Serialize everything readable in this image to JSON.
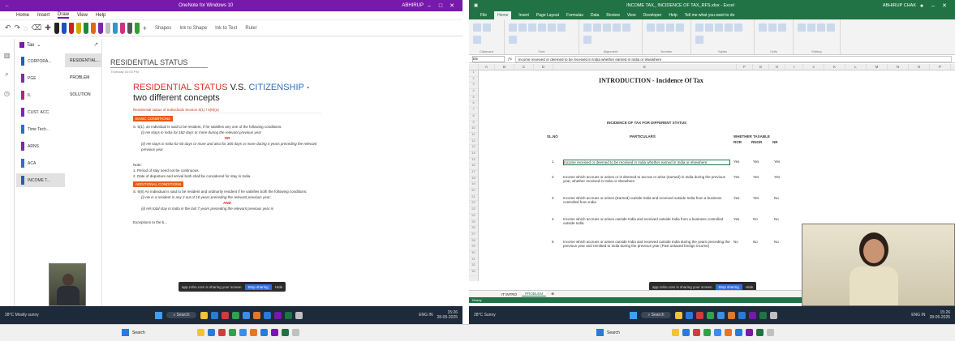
{
  "onenote": {
    "window_title": "OneNote for Windows 10",
    "user": "ABHIRUP",
    "menu": [
      "Home",
      "Insert",
      "Draw",
      "View",
      "Help"
    ],
    "active_menu": "Draw",
    "pen_colors": [
      "#222222",
      "#1f4fbf",
      "#d02020",
      "#d7a500",
      "#1a8a3a",
      "#e06a10",
      "#7a2ab0",
      "#c0c0c0",
      "#2a9ad0",
      "#d03080",
      "#555555",
      "#30a030"
    ],
    "tools": [
      "Shapes",
      "Ink to Shape",
      "Ink to Text",
      "Ruler"
    ],
    "notebook": "Tax",
    "sections": [
      {
        "label": "CORPORA...",
        "color": "#1f5fbf"
      },
      {
        "label": "PGE",
        "color": "#7a2ab0"
      },
      {
        "label": "IL",
        "color": "#c0207a"
      },
      {
        "label": "CUST. ACC.",
        "color": "#7a2ab0"
      },
      {
        "label": "Time Tech...",
        "color": "#2a70d0"
      },
      {
        "label": "ARNS",
        "color": "#7a2ab0"
      },
      {
        "label": "ACA",
        "color": "#2a70d0"
      },
      {
        "label": "INCOME T...",
        "color": "#1f5fbf"
      }
    ],
    "pages": [
      "RESIDENTIAL...",
      "PROBLEM",
      "SOLUTION"
    ],
    "page_title": "RESIDENTIAL STATUS",
    "page_date": "Thursday 02:00 PM",
    "heading_red": "RESIDENTIAL STATUS",
    "heading_vs": " V.S. ",
    "heading_blue": "CITIZENSHIP",
    "heading_rest": " - two different concepts",
    "sub_heading": "Residential status of Individuals Section 6(1) / 6(6)(a)",
    "basic_label": "BASIC CONDITIONS",
    "basic_intro": "S. 6(1), an individual is said to be resident, if he satisfies any one of the following conditions:",
    "basic_i": "(i) He stays in India for 182 days or more during the relevant previous year",
    "or_label": "OR",
    "basic_ii": "(ii) He stays in India for 60 days or more and also for 365 days or more during 4 years preceding the relevant previous year",
    "note_label": "Note:",
    "note_1": "1. Period of stay need not be continuous.",
    "note_2": "2. Date of departure and arrival both shall be considered for stay in India.",
    "add_label": "ADDITIONAL CONDITIONS",
    "add_intro": "S. 6(6) An individual is said to be resident and ordinarily resident if he satisfies both the following conditions:",
    "add_i": "(i) He is a resident in any 2 out of 10 years preceding the relevant previous year;",
    "and_label": "AND",
    "add_ii": "(ii) His total stay in India in the last 7 years preceding the relevant previous year is",
    "exceptions": "Exceptions to the b...",
    "share_msg": "app.zoho.com is sharing your screen",
    "share_stop": "Stop sharing",
    "share_hide": "Hide",
    "weather": "28°C",
    "weather_sub": "Mostly sunny",
    "search": "Search",
    "clock_time": "15:26",
    "clock_date": "28-05-2025",
    "lang": "ENG IN"
  },
  "excel": {
    "window_title": "INCOME TAX_ INCIDENCE OF TAX_RFS.xlsx - Excel",
    "user": "ABHIRUP CHAK",
    "menu": [
      "File",
      "Home",
      "Insert",
      "Page Layout",
      "Formulas",
      "Data",
      "Review",
      "View",
      "Developer",
      "Help",
      "Tell me what you want to do"
    ],
    "active_menu": "Home",
    "ribbon_groups": [
      "Clipboard",
      "Font",
      "Alignment",
      "Number",
      "Styles",
      "Cells",
      "Editing"
    ],
    "name_box": "D5",
    "formula": "Income received or deemed to be received in India whether earned in India or elsewhere",
    "columns": [
      "A",
      "B",
      "C",
      "D",
      "E",
      "F",
      "G",
      "H",
      "I",
      "J",
      "K",
      "L",
      "M",
      "N",
      "O",
      "P"
    ],
    "title": "INTRODUCTION - Incidence Of Tax",
    "subtitle": "INCIDENCE OF TAX FOR DIFFERENT STATUS",
    "hdr_slno": "SL.NO",
    "hdr_particulars": "PARTICULARS",
    "hdr_whether": "WHETHER TAXABLE",
    "hdr_status": [
      "ROR",
      "RNOR",
      "NR"
    ],
    "rows": [
      {
        "no": "1",
        "text": "Income received or deemed to be received in India whether earned in India or elsewhere",
        "ror": "Yes",
        "rnor": "Yes",
        "nr": "Yes"
      },
      {
        "no": "2",
        "text": "Income which accrues or arises or is deemed to accrue or arise (earned) in India during the previous year, whether received in India or elsewhere",
        "ror": "Yes",
        "rnor": "Yes",
        "nr": "Yes"
      },
      {
        "no": "3",
        "text": "Income which accrues or arises (Earned) outside India and received outside India from a business controlled from India",
        "ror": "Yes",
        "rnor": "Yes",
        "nr": "No"
      },
      {
        "no": "4",
        "text": "Income which accrues or arises outside India and received outside India from a business controlled outside India",
        "ror": "Yes",
        "rnor": "No",
        "nr": "No"
      },
      {
        "no": "5",
        "text": "Income which accrues or arises outside India and received outside India during the years preceding the previous year and remitted to India during the previous year (Past untaxed foreign income)",
        "ror": "No",
        "rnor": "No",
        "nr": "No"
      }
    ],
    "sheet_tabs": [
      "IT INTRO",
      "PROBLEM"
    ],
    "status": "Ready",
    "share_msg": "app.zoho.com is sharing your screen",
    "share_stop": "Stop sharing",
    "share_hide": "Hide",
    "weather": "28°C",
    "weather_sub": "Sunny",
    "search": "Search",
    "clock_time": "15:26",
    "clock_date": "28-05-2025",
    "lang": "ENG IN"
  }
}
